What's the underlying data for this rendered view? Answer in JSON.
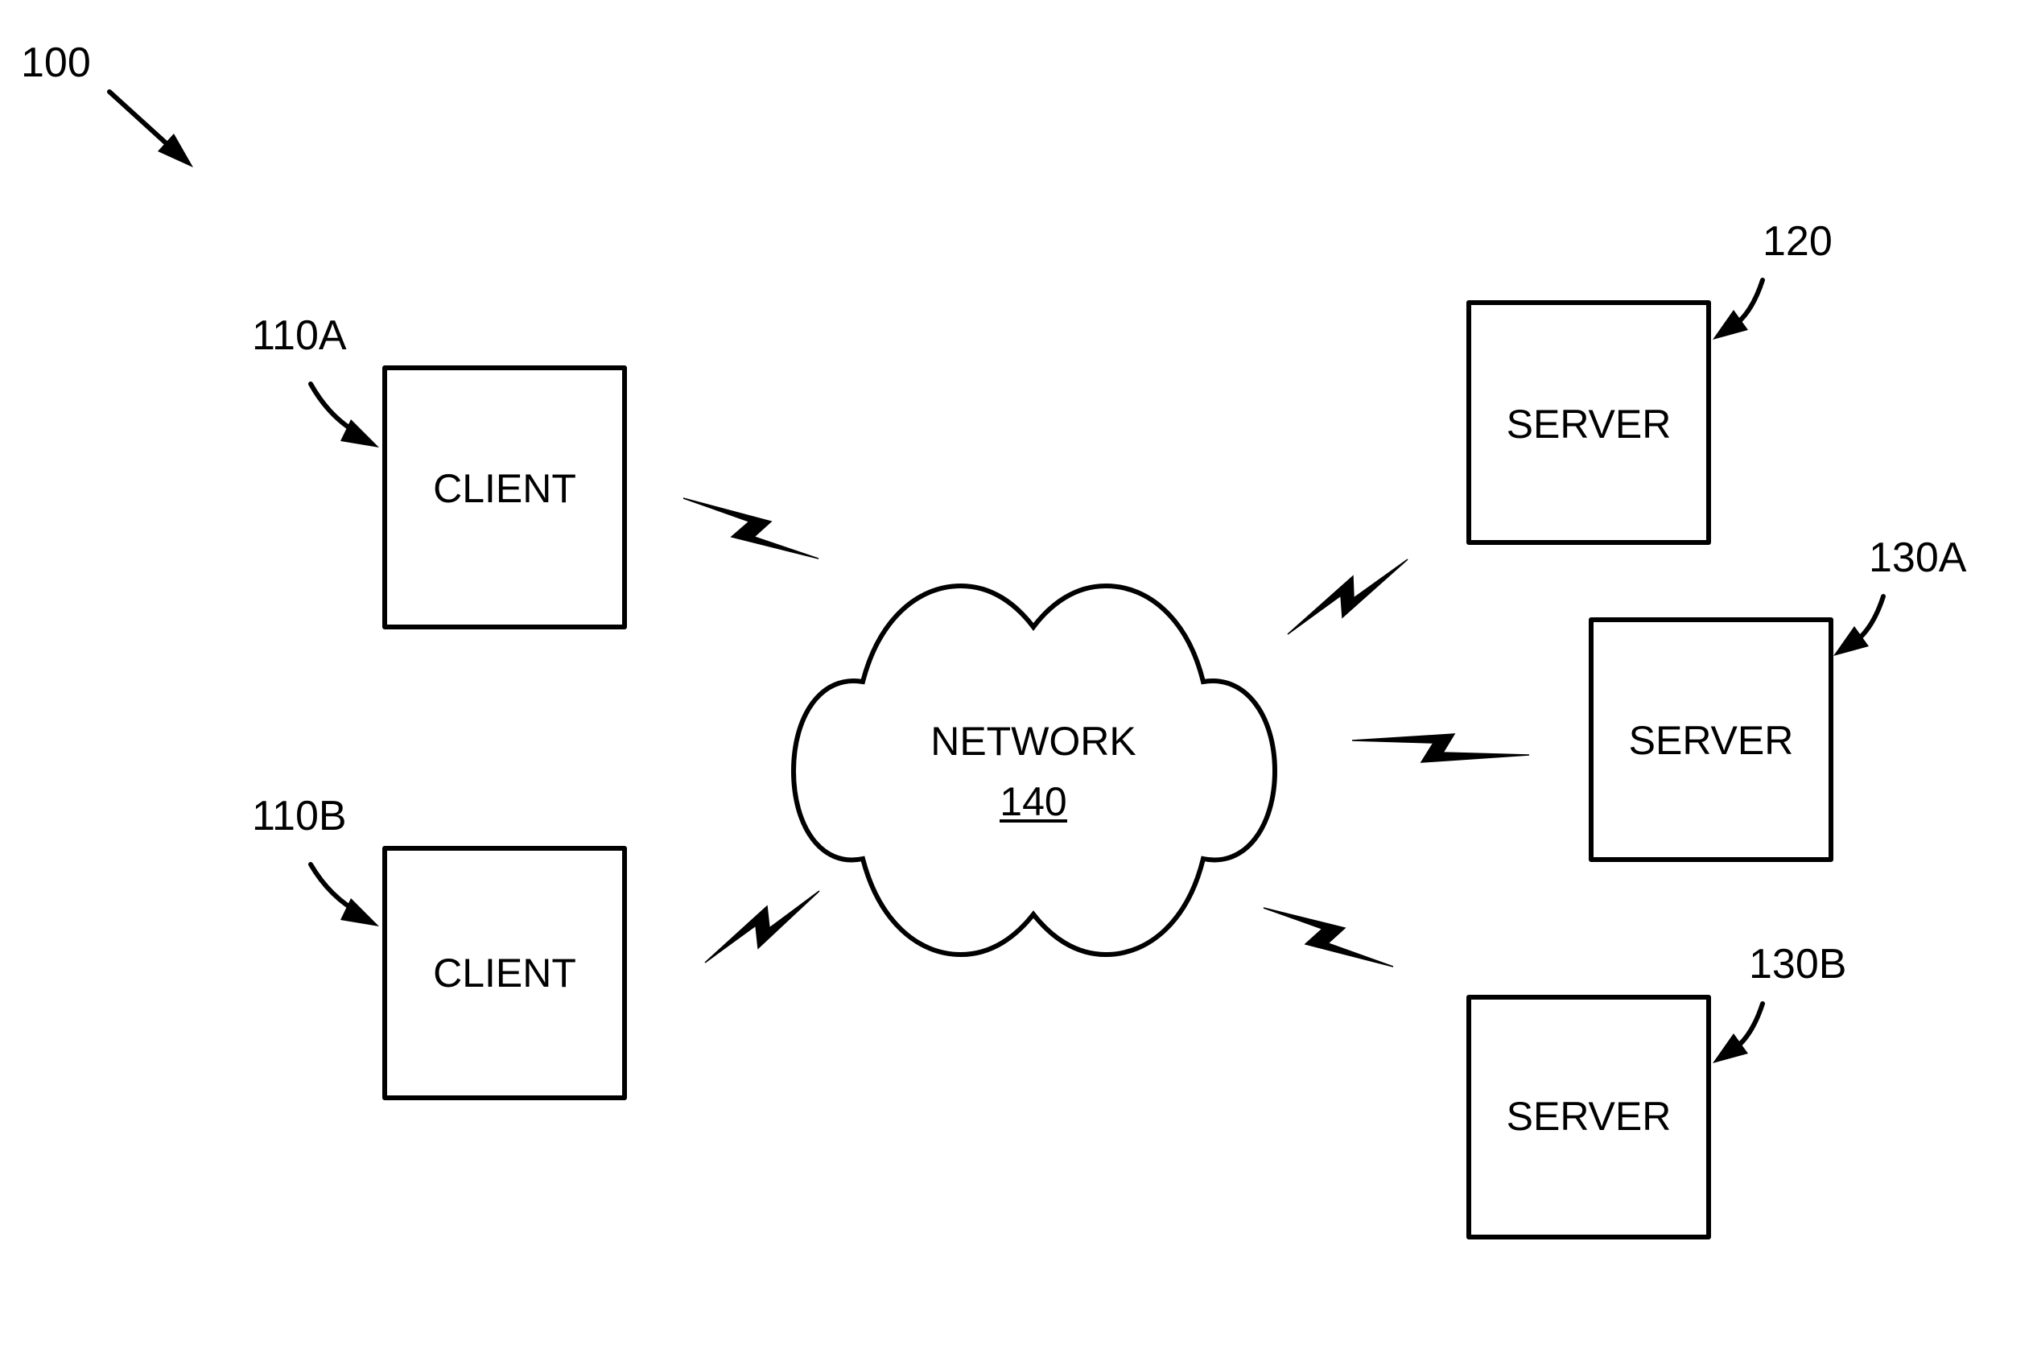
{
  "figure": {
    "reference": "100",
    "colors": {
      "line": "#000000",
      "background": "#ffffff"
    }
  },
  "clients": [
    {
      "ref": "110A",
      "label": "CLIENT"
    },
    {
      "ref": "110B",
      "label": "CLIENT"
    }
  ],
  "servers": [
    {
      "ref": "120",
      "label": "SERVER"
    },
    {
      "ref": "130A",
      "label": "SERVER"
    },
    {
      "ref": "130B",
      "label": "SERVER"
    }
  ],
  "network": {
    "label": "NETWORK",
    "ref": "140"
  },
  "connections": [
    {
      "from": "110A",
      "to": "140",
      "type": "wireless"
    },
    {
      "from": "110B",
      "to": "140",
      "type": "wireless"
    },
    {
      "from": "140",
      "to": "120",
      "type": "wireless"
    },
    {
      "from": "140",
      "to": "130A",
      "type": "wireless"
    },
    {
      "from": "140",
      "to": "130B",
      "type": "wireless"
    }
  ]
}
